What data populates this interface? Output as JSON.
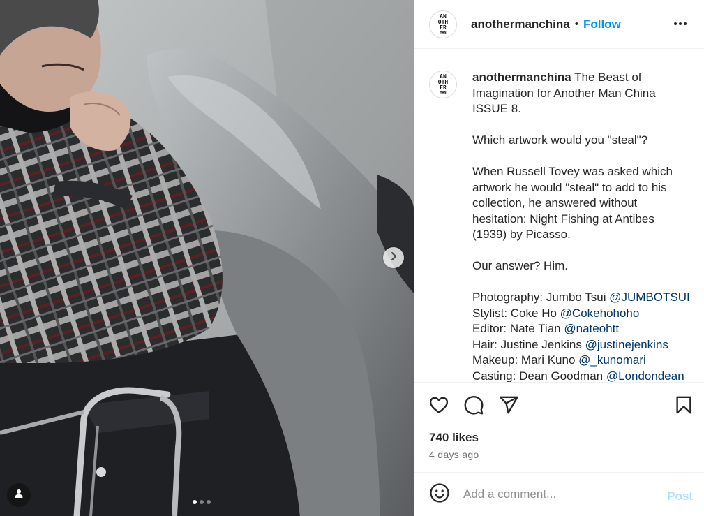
{
  "post": {
    "username": "anothermanchina",
    "follow_label": "Follow",
    "separator": "•",
    "avatar_text": [
      "AN",
      "OTH",
      "ER",
      "MAN"
    ],
    "caption": {
      "username": "anothermanchina",
      "lines": [
        {
          "text": "The Beast of Imagination for Another Man China ISSUE 8."
        },
        {
          "text": ""
        },
        {
          "text": "Which artwork would you \"steal\"?"
        },
        {
          "text": ""
        },
        {
          "text": "When Russell Tovey was asked which artwork he would \"steal\" to add to his collection, he answered without hesitation: Night Fishing at Antibes (1939) by Picasso."
        },
        {
          "text": ""
        },
        {
          "text": "Our answer? Him."
        },
        {
          "text": ""
        }
      ],
      "credits": [
        {
          "role": "Photography: Jumbo Tsui",
          "handle": "@JUMBOTSUI"
        },
        {
          "role": "Stylist: Coke Ho",
          "handle": "@Cokehohoho"
        },
        {
          "role": "Editor: Nate Tian",
          "handle": "@nateohtt"
        },
        {
          "role": "Hair: Justine Jenkins",
          "handle": "@justinejenkins"
        },
        {
          "role": "Makeup: Mari Kuno",
          "handle": "@_kunomari"
        },
        {
          "role": "Casting: Dean Goodman",
          "handle": "@Londondean"
        }
      ]
    },
    "likes": "740 likes",
    "time_ago": "4 days ago",
    "carousel": {
      "total": 3,
      "active": 1
    }
  },
  "actions": {
    "like_icon": "heart-icon",
    "comment_icon": "comment-bubble-icon",
    "share_icon": "paper-plane-icon",
    "save_icon": "bookmark-icon"
  },
  "comment": {
    "placeholder": "Add a comment...",
    "post_label": "Post",
    "emoji_icon": "smiley-icon"
  },
  "colors": {
    "link_blue": "#0095f6",
    "mention_blue": "#00376b",
    "post_disabled": "#b2dffc"
  }
}
